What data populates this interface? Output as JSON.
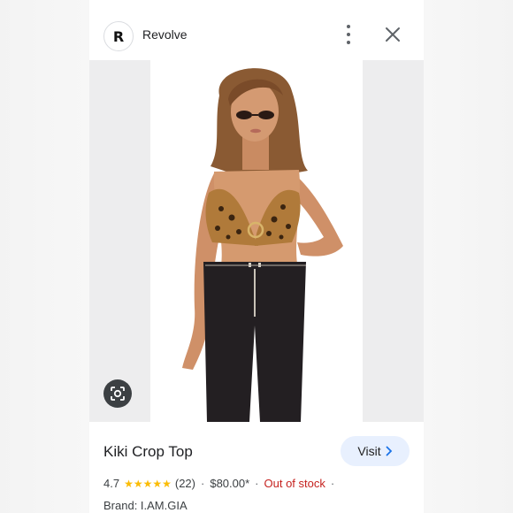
{
  "header": {
    "avatar_letter": "R",
    "site_name": "Revolve",
    "icons": {
      "more": "more-vert-icon",
      "close": "close-icon"
    }
  },
  "image": {
    "subject": "model wearing leopard print halter crop top and black trousers",
    "lens_icon": "lens-search-icon"
  },
  "product": {
    "title": "Kiki Crop Top",
    "visit_label": "Visit",
    "rating": "4.7",
    "stars": 4.7,
    "star_glyphs": "★★★★★",
    "reviews": "(22)",
    "price": "$80.00*",
    "availability": "Out of stock",
    "brand": "Brand: I.AM.GIA"
  },
  "colors": {
    "star": "#fbbc04",
    "out_of_stock": "#c5221f",
    "visit_bg": "#e8f0fe",
    "link_blue": "#1a73e8"
  }
}
